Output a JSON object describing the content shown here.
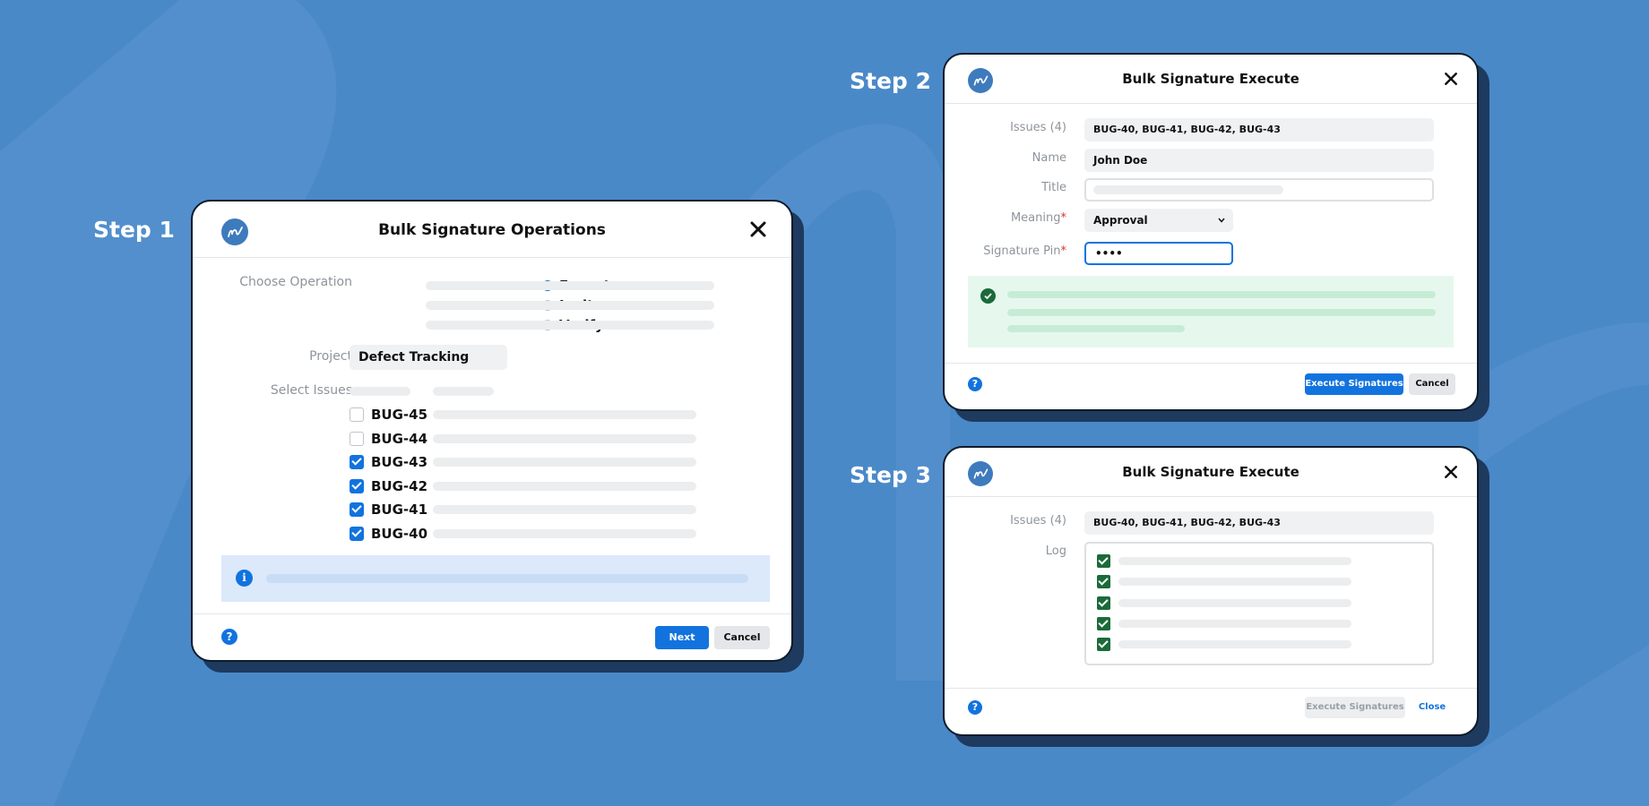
{
  "colors": {
    "background": "#4a89c8",
    "primary": "#1273de",
    "success": "#1b6b3a",
    "success_bg": "#e6f8ee",
    "info_bg": "#dbe9fb",
    "required": "#d0342c"
  },
  "steps": {
    "step1": "Step 1",
    "step2": "Step 2",
    "step3": "Step 3"
  },
  "dialog1": {
    "title": "Bulk Signature Operations",
    "logo_icon": "signature-logo-icon",
    "choose_operation_label": "Choose Operation",
    "operations": [
      {
        "label": "Execute",
        "selected": true
      },
      {
        "label": "Invite",
        "selected": false
      },
      {
        "label": "Verify",
        "selected": false
      }
    ],
    "project_label": "Project",
    "project_value": "Defect Tracking",
    "select_issues_label": "Select Issues",
    "issues": [
      {
        "key": "BUG-45",
        "checked": false
      },
      {
        "key": "BUG-44",
        "checked": false
      },
      {
        "key": "BUG-43",
        "checked": true
      },
      {
        "key": "BUG-42",
        "checked": true
      },
      {
        "key": "BUG-41",
        "checked": true
      },
      {
        "key": "BUG-40",
        "checked": true
      }
    ],
    "help": "?",
    "next_label": "Next",
    "cancel_label": "Cancel"
  },
  "dialog2": {
    "title": "Bulk Signature Execute",
    "issues_label": "Issues (4)",
    "issues_value": "BUG-40, BUG-41, BUG-42, BUG-43",
    "name_label": "Name",
    "name_value": "John Doe",
    "title_label": "Title",
    "meaning_label": "Meaning",
    "meaning_value": "Approval",
    "pin_label": "Signature Pin",
    "pin_value": "••••",
    "required_mark": "*",
    "help": "?",
    "execute_label": "Execute Signatures",
    "cancel_label": "Cancel"
  },
  "dialog3": {
    "title": "Bulk Signature Execute",
    "issues_label": "Issues (4)",
    "issues_value": "BUG-40, BUG-41, BUG-42, BUG-43",
    "log_label": "Log",
    "help": "?",
    "execute_label": "Execute Signatures",
    "close_label": "Close"
  }
}
